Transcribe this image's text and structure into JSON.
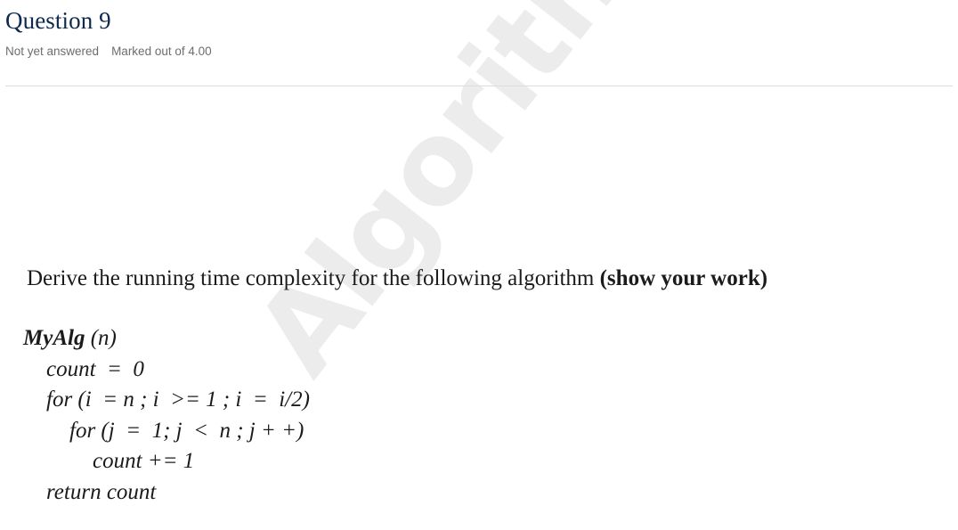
{
  "header": {
    "title": "Question 9",
    "status": "Not yet answered",
    "marks": "Marked out of 4.00"
  },
  "watermark": {
    "text": "Algorithms",
    "color": "#ececec"
  },
  "colors": {
    "title": "#0d2a4e",
    "status_text": "#6d6d6d",
    "divider": "#dcdcdc",
    "body_text": "#1b1b1b",
    "page_background": "#ffffff"
  },
  "question": {
    "prompt_plain": "Derive the running time complexity for the following algorithm ",
    "prompt_bold": "(show your work)",
    "algorithm": {
      "lines": [
        {
          "indent": 0,
          "name": "MyAlg",
          "text": " (n)"
        },
        {
          "indent": 1,
          "name": "",
          "text": "count  =  0"
        },
        {
          "indent": 1,
          "name": "",
          "text": "for (i  = n ; i  >= 1 ; i  =  i/2)"
        },
        {
          "indent": 2,
          "name": "",
          "text": "for (j  =  1; j  <  n ; j + +)"
        },
        {
          "indent": 3,
          "name": "",
          "text": "count += 1"
        },
        {
          "indent": 1,
          "name": "",
          "text": "return count"
        }
      ]
    }
  }
}
